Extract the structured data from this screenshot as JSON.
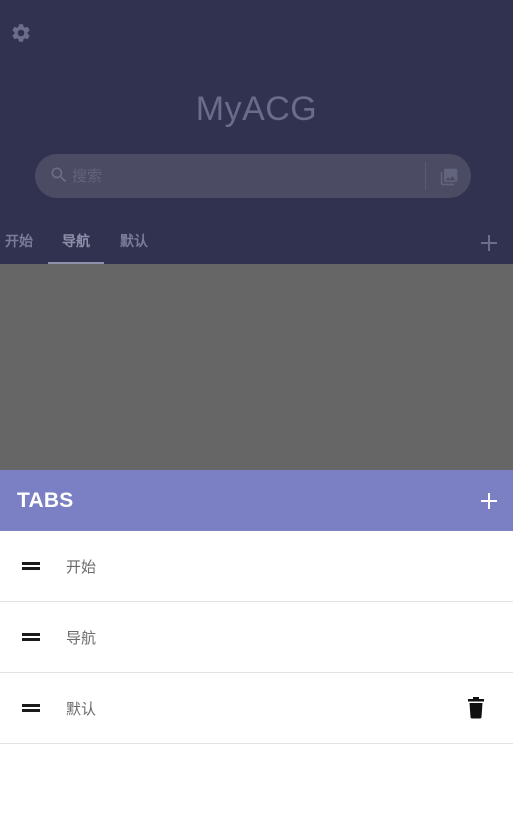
{
  "app": {
    "title": "MyACG",
    "search": {
      "placeholder": "搜索"
    },
    "tabs": [
      {
        "label": "开始"
      },
      {
        "label": "导航"
      },
      {
        "label": "默认"
      }
    ],
    "active_tab": "导航"
  },
  "sheet": {
    "title": "TABS",
    "items": [
      {
        "label": "开始"
      },
      {
        "label": "导航"
      },
      {
        "label": "默认"
      }
    ]
  },
  "icons": {
    "settings": "gear-icon",
    "search": "search-icon",
    "gallery": "image-gallery-icon",
    "add": "plus-icon",
    "drag": "drag-handle-icon",
    "delete": "trash-icon"
  },
  "colors": {
    "header_bg": "#313150",
    "sheet_header_bg": "#7b7fc4",
    "scrim_content": "#666666"
  }
}
